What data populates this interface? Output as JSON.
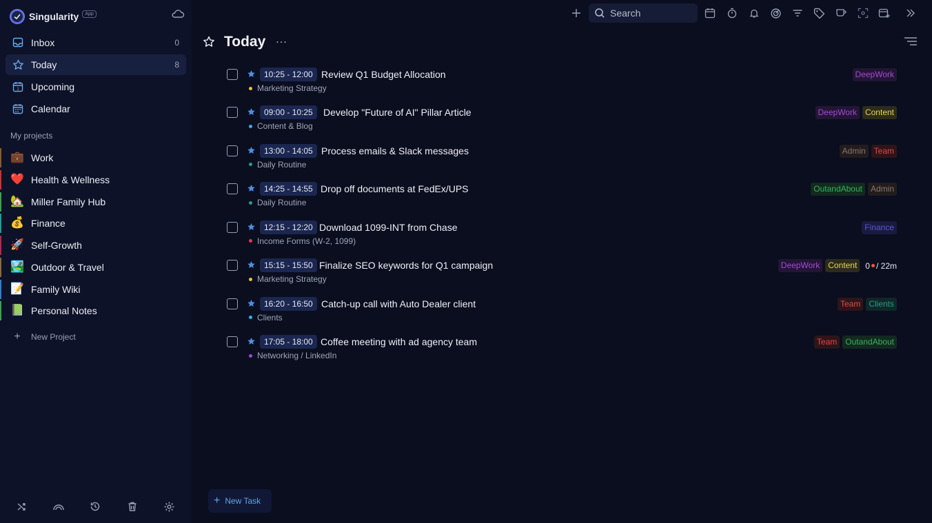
{
  "app": {
    "name": "Singularity",
    "badge": "App"
  },
  "nav": [
    {
      "label": "Inbox",
      "count": "0",
      "icon": "inbox-icon"
    },
    {
      "label": "Today",
      "count": "8",
      "icon": "star-icon"
    },
    {
      "label": "Upcoming",
      "count": "",
      "icon": "calendar-upcoming-icon"
    },
    {
      "label": "Calendar",
      "count": "",
      "icon": "calendar-icon"
    }
  ],
  "projects_label": "My projects",
  "projects": [
    {
      "label": "Work",
      "emoji": "💼",
      "color": "#8a5a2b"
    },
    {
      "label": "Health & Wellness",
      "emoji": "❤️",
      "color": "#d0302f"
    },
    {
      "label": "Miller Family Hub",
      "emoji": "🏡",
      "color": "#3aa548"
    },
    {
      "label": "Finance",
      "emoji": "💰",
      "color": "#1f9e91"
    },
    {
      "label": "Self-Growth",
      "emoji": "🚀",
      "color": "#b8264a"
    },
    {
      "label": "Outdoor & Travel",
      "emoji": "🏞️",
      "color": "#8a6a3b"
    },
    {
      "label": "Family Wiki",
      "emoji": "📝",
      "color": "#2f7fd0"
    },
    {
      "label": "Personal Notes",
      "emoji": "📗",
      "color": "#3aa548"
    }
  ],
  "new_project": "New Project",
  "search": {
    "placeholder": "Search"
  },
  "page": {
    "title": "Today"
  },
  "tasks": [
    {
      "time": "10:25 - 12:00",
      "title": "Review Q1 Budget Allocation",
      "project": "Marketing Strategy",
      "dot": "#e8c33a",
      "tags": [
        {
          "label": "DeepWork",
          "cls": "deepwork"
        }
      ]
    },
    {
      "time": "09:00 - 10:25",
      "title": "Develop \"Future of AI\" Pillar Article",
      "project": "Content & Blog",
      "dot": "#4aa5e0",
      "tags": [
        {
          "label": "DeepWork",
          "cls": "deepwork"
        },
        {
          "label": "Content",
          "cls": "content"
        }
      ]
    },
    {
      "time": "13:00 - 14:05",
      "title": "Process emails & Slack messages",
      "project": "Daily Routine",
      "dot": "#2f9e7a",
      "tags": [
        {
          "label": "Admin",
          "cls": "admin"
        },
        {
          "label": "Team",
          "cls": "team"
        }
      ]
    },
    {
      "time": "14:25 - 14:55",
      "title": "Drop off documents at FedEx/UPS",
      "project": "Daily Routine",
      "dot": "#2f9e7a",
      "tags": [
        {
          "label": "OutandAbout",
          "cls": "outand"
        },
        {
          "label": "Admin",
          "cls": "admin"
        }
      ]
    },
    {
      "time": "12:15 - 12:20",
      "title": "Download 1099-INT from Chase",
      "project": "Income Forms (W-2, 1099)",
      "dot": "#e03a5a",
      "tags": [
        {
          "label": "Finance",
          "cls": "finance"
        }
      ]
    },
    {
      "time": "15:15 - 15:50",
      "title": "Finalize SEO keywords for Q1 campaign",
      "project": "Marketing Strategy",
      "dot": "#e8c33a",
      "tags": [
        {
          "label": "DeepWork",
          "cls": "deepwork"
        },
        {
          "label": "Content",
          "cls": "content"
        }
      ],
      "tracker": {
        "count": "0",
        "duration": "/ 22m"
      }
    },
    {
      "time": "16:20 - 16:50",
      "title": "Catch-up call with Auto Dealer client",
      "project": "Clients",
      "dot": "#3ab0e0",
      "tags": [
        {
          "label": "Team",
          "cls": "team"
        },
        {
          "label": "Clients",
          "cls": "clients"
        }
      ]
    },
    {
      "time": "17:05 - 18:00",
      "title": "Coffee meeting with ad agency team",
      "project": "Networking / LinkedIn",
      "dot": "#9a4ad8",
      "tags": [
        {
          "label": "Team",
          "cls": "team"
        },
        {
          "label": "OutandAbout",
          "cls": "outand"
        }
      ]
    }
  ],
  "new_task": "New Task",
  "colors": {
    "accent": "#5fa6e8",
    "star": "#4c8fe0",
    "background": "#0a0e1f",
    "sidebar": "#0d1228"
  }
}
